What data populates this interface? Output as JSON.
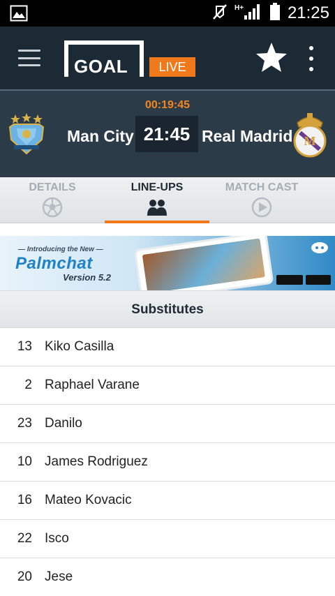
{
  "status_bar": {
    "time": "21:25",
    "network_label": "H+",
    "icons": [
      "image-notification-icon",
      "muted-icon",
      "signal-icon",
      "battery-icon"
    ]
  },
  "app_bar": {
    "logo_text": "GOAL",
    "live_label": "LIVE",
    "icons": [
      "menu-icon",
      "star-icon",
      "more-vert-icon"
    ]
  },
  "match": {
    "clock": "00:19:45",
    "home_team": "Man City",
    "away_team": "Real Madrid",
    "score": "21:45"
  },
  "tabs": [
    {
      "label": "DETAILS",
      "icon": "soccer-ball-icon",
      "active": false
    },
    {
      "label": "LINE-UPS",
      "icon": "people-icon",
      "active": true
    },
    {
      "label": "MATCH CAST",
      "icon": "play-circle-icon",
      "active": false
    }
  ],
  "ad": {
    "intro": "— Introducing the New —",
    "brand": "Palmchat",
    "version": "Version 5.2"
  },
  "section": {
    "title": "Substitutes"
  },
  "players": [
    {
      "number": "13",
      "name": "Kiko Casilla"
    },
    {
      "number": "2",
      "name": "Raphael Varane"
    },
    {
      "number": "23",
      "name": "Danilo"
    },
    {
      "number": "10",
      "name": "James Rodriguez"
    },
    {
      "number": "16",
      "name": "Mateo Kovacic"
    },
    {
      "number": "22",
      "name": "Isco"
    },
    {
      "number": "20",
      "name": "Jese"
    }
  ],
  "colors": {
    "app_bar": "#1c2a36",
    "match_header": "#2c3b48",
    "accent": "#f07a1b",
    "clock": "#f5861f"
  }
}
